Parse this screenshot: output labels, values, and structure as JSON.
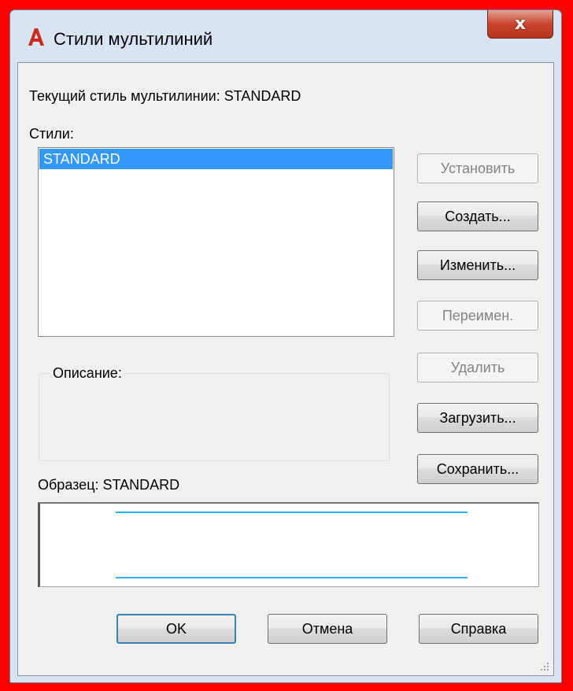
{
  "window": {
    "title": "Стили мультилиний",
    "close_symbol": "x"
  },
  "current_style_text": "Текущий стиль мультилинии: STANDARD",
  "styles": {
    "label": "Стили:",
    "items": [
      "STANDARD"
    ],
    "selected_index": 0
  },
  "buttons": {
    "set_current": "Установить",
    "create": "Создать...",
    "modify": "Изменить...",
    "rename": "Переимен.",
    "delete": "Удалить",
    "load": "Загрузить...",
    "save": "Сохранить..."
  },
  "description": {
    "label": "Описание:",
    "value": ""
  },
  "preview": {
    "label": "Образец: STANDARD",
    "line_color": "#29b6f6"
  },
  "footer": {
    "ok": "OK",
    "cancel": "Отмена",
    "help": "Справка"
  },
  "colors": {
    "frame": "#ff0000",
    "selection": "#3399ff",
    "close_button": "#c74530",
    "app_icon": "#d0271d"
  },
  "icons": {
    "app": "autocad-a-icon",
    "close": "close-icon",
    "grip": "resize-grip-icon"
  }
}
